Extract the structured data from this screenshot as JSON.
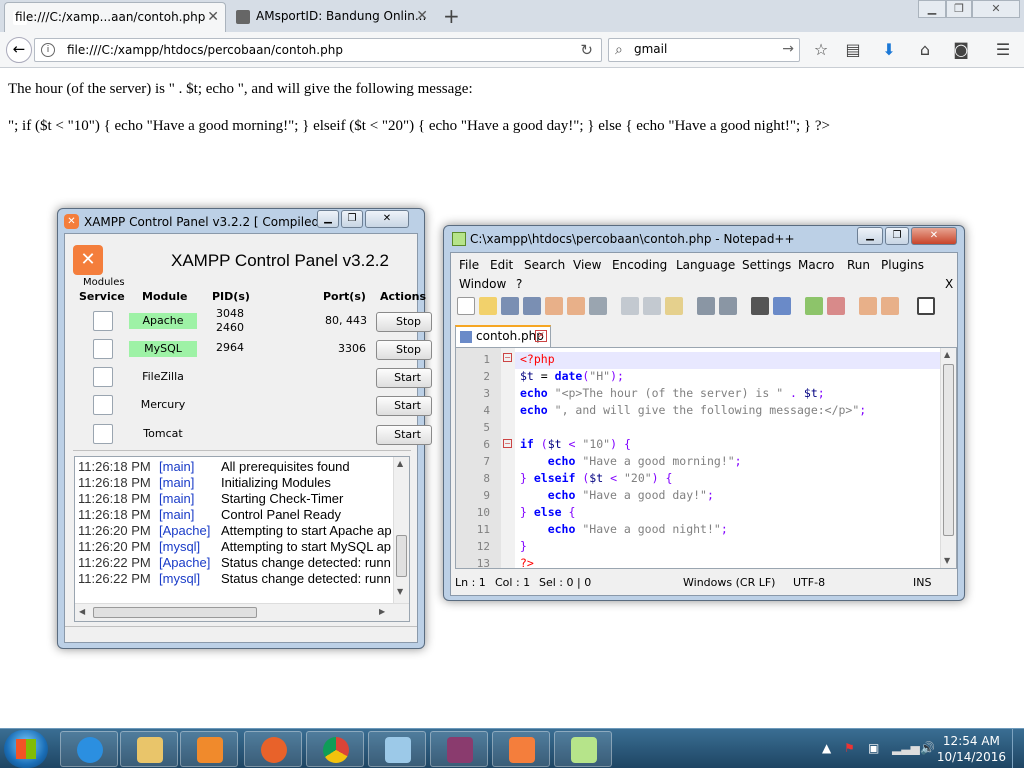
{
  "browser": {
    "tabs": [
      {
        "label": "file:///C:/xamp...aan/contoh.php",
        "active": true
      },
      {
        "label": "AMsportID: Bandung Onlin...",
        "active": false
      }
    ],
    "url": "file:///C:/xampp/htdocs/percobaan/contoh.php",
    "search_value": "gmail"
  },
  "page": {
    "line1": "The hour (of the server) is \" . $t; echo \", and will give the following message:",
    "line2": "\"; if ($t < \"10\") { echo \"Have a good morning!\"; } elseif ($t < \"20\") { echo \"Have a good day!\"; } else { echo \"Have a good night!\"; } ?>"
  },
  "xampp": {
    "window_title": "XAMPP Control Panel v3.2.2   [ Compiled...",
    "heading": "XAMPP Control Panel v3.2.2",
    "modules_label": "Modules",
    "columns": {
      "service": "Service",
      "module": "Module",
      "pid": "PID(s)",
      "port": "Port(s)",
      "actions": "Actions"
    },
    "rows": [
      {
        "module": "Apache",
        "pid1": "3048",
        "pid2": "2460",
        "port": "80, 443",
        "action": "Stop",
        "running": true
      },
      {
        "module": "MySQL",
        "pid1": "2964",
        "pid2": "",
        "port": "3306",
        "action": "Stop",
        "running": true
      },
      {
        "module": "FileZilla",
        "pid1": "",
        "pid2": "",
        "port": "",
        "action": "Start",
        "running": false
      },
      {
        "module": "Mercury",
        "pid1": "",
        "pid2": "",
        "port": "",
        "action": "Start",
        "running": false
      },
      {
        "module": "Tomcat",
        "pid1": "",
        "pid2": "",
        "port": "",
        "action": "Start",
        "running": false
      }
    ],
    "log": [
      {
        "time": "11:26:18 PM",
        "module": "[main]",
        "msg": "All prerequisites found"
      },
      {
        "time": "11:26:18 PM",
        "module": "[main]",
        "msg": "Initializing Modules"
      },
      {
        "time": "11:26:18 PM",
        "module": "[main]",
        "msg": "Starting Check-Timer"
      },
      {
        "time": "11:26:18 PM",
        "module": "[main]",
        "msg": "Control Panel Ready"
      },
      {
        "time": "11:26:20 PM",
        "module": "[Apache]",
        "msg": "Attempting to start Apache ap"
      },
      {
        "time": "11:26:20 PM",
        "module": "[mysql]",
        "msg": "Attempting to start MySQL ap"
      },
      {
        "time": "11:26:22 PM",
        "module": "[Apache]",
        "msg": "Status change detected: runn"
      },
      {
        "time": "11:26:22 PM",
        "module": "[mysql]",
        "msg": "Status change detected: runn"
      }
    ]
  },
  "npp": {
    "window_title": "C:\\xampp\\htdocs\\percobaan\\contoh.php - Notepad++",
    "menu": [
      "File",
      "Edit",
      "Search",
      "View",
      "Encoding",
      "Language",
      "Settings",
      "Macro",
      "Run",
      "Plugins"
    ],
    "menu_row2": [
      "Window",
      "?"
    ],
    "menu_close": "X",
    "tab_label": "contoh.php",
    "line_numbers": [
      "1",
      "2",
      "3",
      "4",
      "5",
      "6",
      "7",
      "8",
      "9",
      "10",
      "11",
      "12",
      "13"
    ],
    "status": {
      "ln": "Ln : 1",
      "col": "Col : 1",
      "sel": "Sel : 0 | 0",
      "eol": "Windows (CR LF)",
      "enc": "UTF-8",
      "ins": "INS"
    }
  },
  "taskbar": {
    "time": "12:54 AM",
    "date": "10/14/2016"
  }
}
